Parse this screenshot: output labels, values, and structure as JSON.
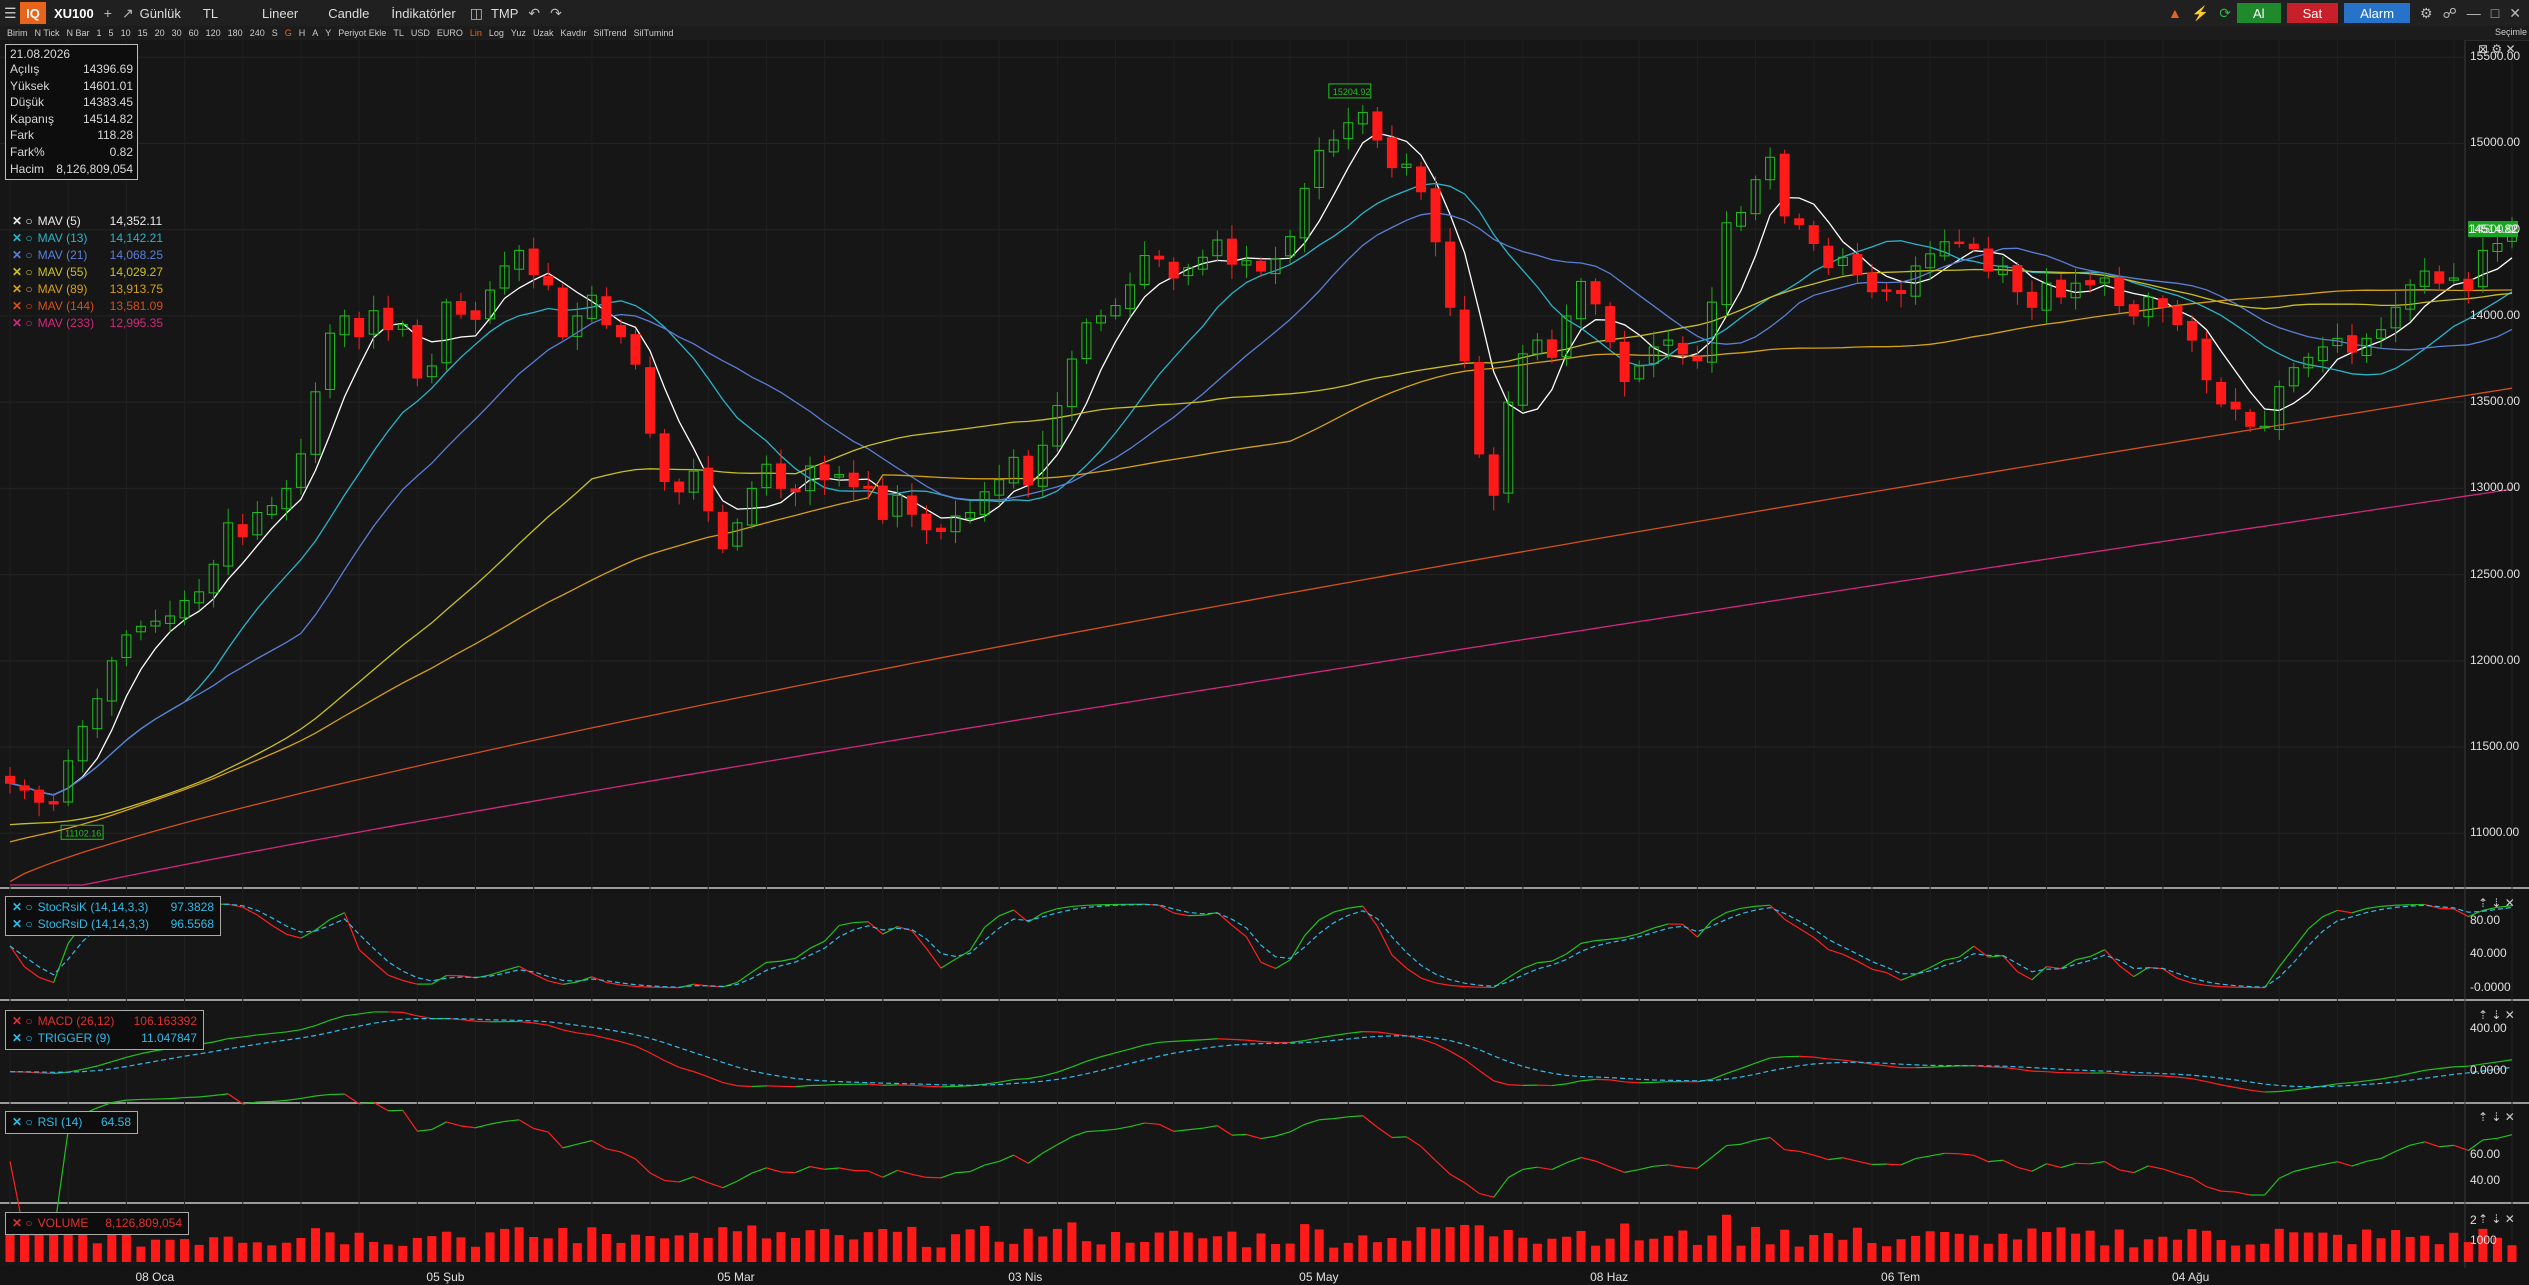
{
  "topbar": {
    "logo": "IQ",
    "symbol": "XU100",
    "add": "+",
    "period": "Günlük",
    "currency": "TL",
    "scale": "Lineer",
    "chart_type": "Candle",
    "indicators": "İndikatörler",
    "template": "TMP",
    "buy_label": "Al",
    "sell_label": "Sat",
    "alarm_label": "Alarm",
    "corner_label": "Seçimle"
  },
  "toolbar": {
    "items": [
      "Birim",
      "N Tick",
      "N Bar",
      "1",
      "5",
      "10",
      "15",
      "20",
      "30",
      "60",
      "120",
      "180",
      "240",
      "S",
      "G",
      "H",
      "A",
      "Y",
      "Periyot Ekle",
      "TL",
      "USD",
      "EURO",
      "Lin",
      "Log",
      "Yuz",
      "Uzak",
      "Kavdır",
      "SilTrend",
      "SilTumind"
    ],
    "highlighted": [
      "G",
      "Lin"
    ]
  },
  "ohlc": {
    "date": "21.08.2026",
    "rows": [
      {
        "label": "Açılış",
        "value": "14396.69"
      },
      {
        "label": "Yüksek",
        "value": "14601.01"
      },
      {
        "label": "Düşük",
        "value": "14383.45"
      },
      {
        "label": "Kapanış",
        "value": "14514.82"
      },
      {
        "label": "Fark",
        "value": "118.28"
      },
      {
        "label": "Fark%",
        "value": "0.82"
      },
      {
        "label": "Hacim",
        "value": "8,126,809,054"
      }
    ]
  },
  "moving_averages": [
    {
      "name": "MAV (5)",
      "value": "14,352.11",
      "color": "#ffffff"
    },
    {
      "name": "MAV (13)",
      "value": "14,142.21",
      "color": "#2bb3c8"
    },
    {
      "name": "MAV (21)",
      "value": "14,068.25",
      "color": "#5b7fd6"
    },
    {
      "name": "MAV (55)",
      "value": "14,029.27",
      "color": "#c8c020"
    },
    {
      "name": "MAV (89)",
      "value": "13,913.75",
      "color": "#d4a017"
    },
    {
      "name": "MAV (144)",
      "value": "13,581.09",
      "color": "#d2501a"
    },
    {
      "name": "MAV (233)",
      "value": "12,995.35",
      "color": "#d0287f"
    }
  ],
  "indicators": {
    "stochrsi": [
      {
        "name": "StocRsiK (14,14,3,3)",
        "value": "97.3828",
        "color": "#32b9e6"
      },
      {
        "name": "StocRsiD (14,14,3,3)",
        "value": "96.5568",
        "color": "#32b9e6"
      }
    ],
    "macd": [
      {
        "name": "MACD (26,12)",
        "value": "106.163392",
        "color": "#e03030"
      },
      {
        "name": "TRIGGER (9)",
        "value": "11.047847",
        "color": "#32b9e6"
      }
    ],
    "rsi": [
      {
        "name": "RSI (14)",
        "value": "64.58",
        "color": "#32b9e6"
      }
    ],
    "volume": [
      {
        "name": "VOLUME",
        "value": "8,126,809,054",
        "color": "#e03030"
      }
    ]
  },
  "price_tag": "14514.82",
  "annotations": {
    "high_box": "15204.92",
    "low_box": "11102.16"
  },
  "price_axis_labels": [
    "15500.00",
    "15000.00",
    "14500.00",
    "14000.00",
    "13500.00",
    "13000.00",
    "12500.00",
    "12000.00",
    "11500.00",
    "11000.00"
  ],
  "stoch_axis_labels": [
    "80.00",
    "40.000",
    "-0.0000"
  ],
  "macd_axis_labels": [
    "400.00",
    "0.0000"
  ],
  "rsi_axis_labels": [
    "60.00",
    "40.00"
  ],
  "vol_axis_labels": [
    "2",
    "1000"
  ],
  "chart_data": {
    "type": "candlestick",
    "title": "XU100",
    "ylim": [
      10700,
      15600
    ],
    "x_tick_labels": [
      {
        "label": "08 Oca",
        "index": 10
      },
      {
        "label": "05 Şub",
        "index": 30
      },
      {
        "label": "05 Mar",
        "index": 50
      },
      {
        "label": "03 Nis",
        "index": 70
      },
      {
        "label": "05 May",
        "index": 90
      },
      {
        "label": "08 Haz",
        "index": 110
      },
      {
        "label": "06 Tem",
        "index": 130
      },
      {
        "label": "04 Ağu",
        "index": 150
      }
    ],
    "close": [
      11290,
      11250,
      11180,
      11170,
      11420,
      11620,
      11780,
      12000,
      12150,
      12200,
      12230,
      12260,
      12350,
      12400,
      12560,
      12800,
      12720,
      12860,
      12900,
      13000,
      13200,
      13560,
      13900,
      14000,
      13880,
      14030,
      13920,
      13950,
      13640,
      13710,
      14080,
      14010,
      13980,
      14150,
      14290,
      14380,
      14240,
      14180,
      13880,
      14000,
      14120,
      13950,
      13880,
      13720,
      13320,
      13040,
      12980,
      13100,
      12870,
      12650,
      12800,
      13000,
      13140,
      13000,
      12980,
      13130,
      13050,
      13080,
      13010,
      13000,
      12820,
      12960,
      12850,
      12760,
      12750,
      12840,
      12860,
      12980,
      13050,
      13180,
      13020,
      13250,
      13480,
      13750,
      13960,
      14000,
      14060,
      14180,
      14350,
      14330,
      14220,
      14280,
      14340,
      14440,
      14300,
      14320,
      14260,
      14330,
      14460,
      14740,
      14960,
      15020,
      15120,
      15180,
      15020,
      14860,
      14880,
      14720,
      14430,
      14050,
      13740,
      13200,
      12960,
      13500,
      13780,
      13860,
      13760,
      14000,
      14200,
      14070,
      13850,
      13620,
      13710,
      13820,
      13860,
      13780,
      13740,
      14080,
      14540,
      14600,
      14790,
      14920,
      14580,
      14530,
      14420,
      14280,
      14340,
      14240,
      14140,
      14150,
      14130,
      14290,
      14360,
      14430,
      14420,
      14390,
      14260,
      14290,
      14140,
      14050,
      14190,
      14110,
      14190,
      14180,
      14220,
      14060,
      14000,
      14110,
      14050,
      13950,
      13860,
      13630,
      13490,
      13460,
      13360,
      13360,
      13590,
      13700,
      13760,
      13820,
      13870,
      13790,
      13870,
      13920,
      14050,
      14180,
      14260,
      14190,
      14220,
      14150,
      14380,
      14420,
      14514.82
    ]
  }
}
